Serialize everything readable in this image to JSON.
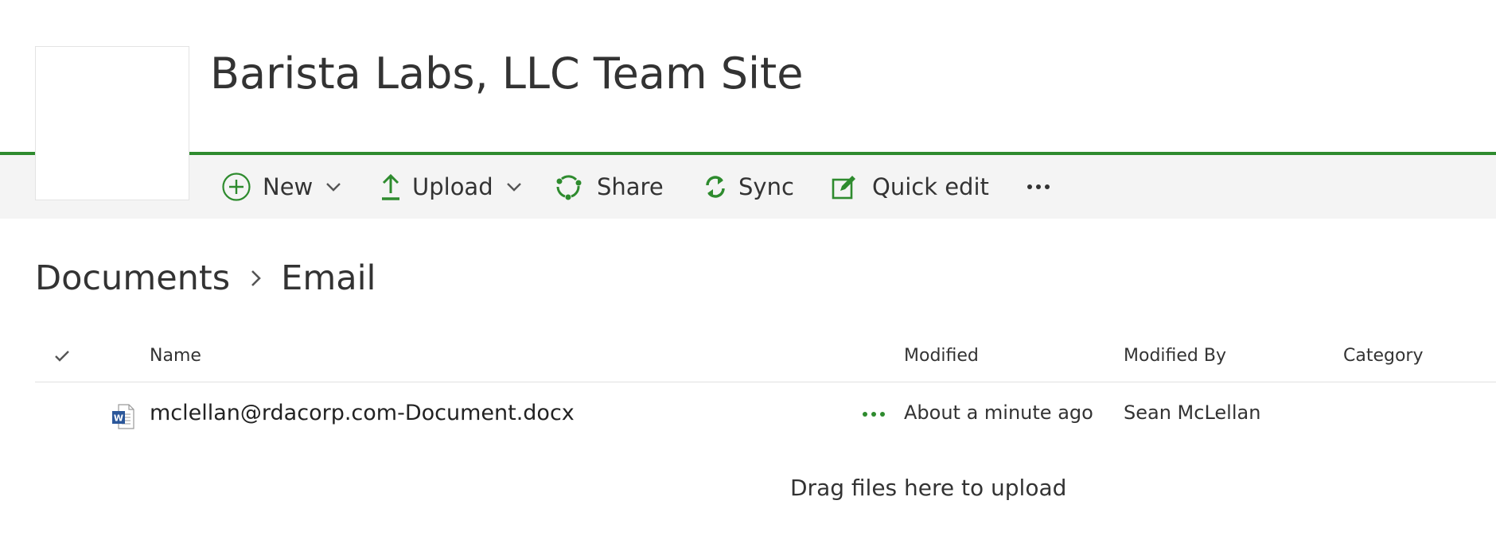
{
  "site": {
    "title": "Barista Labs, LLC Team Site"
  },
  "commands": {
    "new": "New",
    "upload": "Upload",
    "share": "Share",
    "sync": "Sync",
    "quick_edit": "Quick edit"
  },
  "breadcrumb": {
    "root": "Documents",
    "current": "Email"
  },
  "columns": {
    "name": "Name",
    "modified": "Modified",
    "modified_by": "Modified By",
    "category": "Category"
  },
  "files": [
    {
      "name": "mclellan@rdacorp.com-Document.docx",
      "modified": "About a minute ago",
      "modified_by": "Sean McLellan",
      "category": "",
      "icon": "word-doc-icon"
    }
  ],
  "drop_hint": "Drag files here to upload",
  "colors": {
    "accent": "#2e8b2e",
    "command_bar": "#f4f4f4",
    "text": "#333333"
  }
}
